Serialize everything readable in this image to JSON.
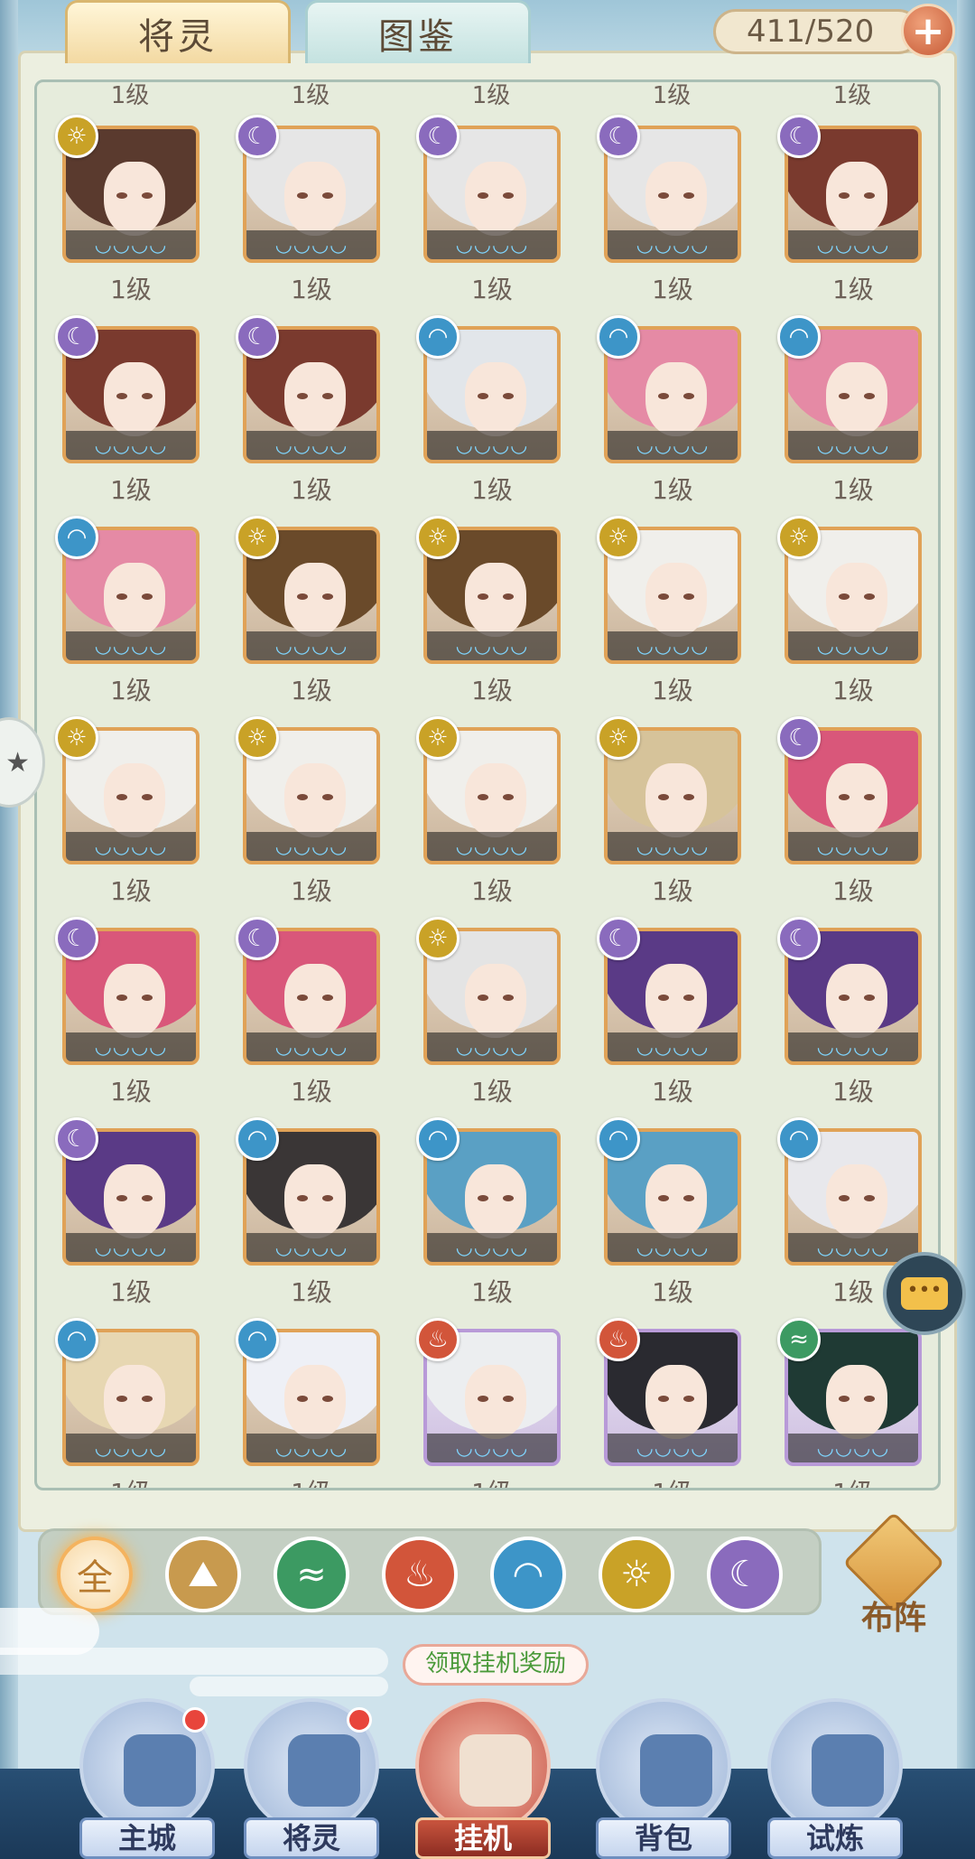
{
  "tabs": [
    {
      "label": "将灵",
      "active": true
    },
    {
      "label": "图鉴",
      "active": false
    }
  ],
  "counter": {
    "text": "411/520",
    "plus": "+"
  },
  "level_label": "1级",
  "drops_glyph": "💧💧💧💧",
  "elements": {
    "light": {
      "name": "light-element-icon",
      "glyph": "☼",
      "color": "#c9a227"
    },
    "moon": {
      "name": "moon-element-icon",
      "glyph": "☾",
      "color": "#8a6bbd"
    },
    "water": {
      "name": "water-element-icon",
      "glyph": "◠",
      "color": "#3d95c8"
    },
    "fire": {
      "name": "fire-element-icon",
      "glyph": "♨",
      "color": "#d2553a"
    },
    "wind": {
      "name": "wind-element-icon",
      "glyph": "≈",
      "color": "#3c9a62"
    }
  },
  "heroes": [
    {
      "element": "light",
      "hair": "#5a3a2e"
    },
    {
      "element": "moon",
      "hair": "#e6e6e6"
    },
    {
      "element": "moon",
      "hair": "#e6e6e6"
    },
    {
      "element": "moon",
      "hair": "#e6e6e6"
    },
    {
      "element": "moon",
      "hair": "#7a3a2e"
    },
    {
      "element": "moon",
      "hair": "#7a3a2e"
    },
    {
      "element": "moon",
      "hair": "#7a3a2e"
    },
    {
      "element": "water",
      "hair": "#e2e6ea"
    },
    {
      "element": "water",
      "hair": "#e58aa5"
    },
    {
      "element": "water",
      "hair": "#e58aa5"
    },
    {
      "element": "water",
      "hair": "#e58aa5"
    },
    {
      "element": "light",
      "hair": "#6a4a2a"
    },
    {
      "element": "light",
      "hair": "#6a4a2a"
    },
    {
      "element": "light",
      "hair": "#f0efeb"
    },
    {
      "element": "light",
      "hair": "#f0efeb"
    },
    {
      "element": "light",
      "hair": "#f0efeb"
    },
    {
      "element": "light",
      "hair": "#f0efeb"
    },
    {
      "element": "light",
      "hair": "#f0efeb"
    },
    {
      "element": "light",
      "hair": "#d6c39a"
    },
    {
      "element": "moon",
      "hair": "#d9577a"
    },
    {
      "element": "moon",
      "hair": "#d9577a"
    },
    {
      "element": "moon",
      "hair": "#d9577a"
    },
    {
      "element": "light",
      "hair": "#e4e4e4"
    },
    {
      "element": "moon",
      "hair": "#5a3a86"
    },
    {
      "element": "moon",
      "hair": "#5a3a86"
    },
    {
      "element": "moon",
      "hair": "#5a3a86"
    },
    {
      "element": "water",
      "hair": "#3a3636"
    },
    {
      "element": "water",
      "hair": "#5aa0c4"
    },
    {
      "element": "water",
      "hair": "#5aa0c4"
    },
    {
      "element": "water",
      "hair": "#e8e8ec"
    },
    {
      "element": "water",
      "hair": "#e7d7b2"
    },
    {
      "element": "water",
      "hair": "#eef0f6"
    },
    {
      "element": "fire",
      "hair": "#eceef0",
      "rare": true
    },
    {
      "element": "fire",
      "hair": "#2a2a30",
      "rare": true
    },
    {
      "element": "wind",
      "hair": "#1f3a34",
      "rare": true
    }
  ],
  "filters": [
    {
      "name": "filter-all-button",
      "label": "全"
    },
    {
      "name": "filter-mountain-button",
      "label": "⛰",
      "color": "#c89a4e"
    },
    {
      "name": "filter-wind-button",
      "label": "≈",
      "color": "#3c9a62"
    },
    {
      "name": "filter-fire-button",
      "label": "♨",
      "color": "#d2553a"
    },
    {
      "name": "filter-water-button",
      "label": "◠",
      "color": "#3d95c8"
    },
    {
      "name": "filter-light-button",
      "label": "☼",
      "color": "#c9a227"
    },
    {
      "name": "filter-moon-button",
      "label": "☾",
      "color": "#8a6bbd"
    }
  ],
  "buzhen_label": "布阵",
  "reward_tag": "领取挂机奖励",
  "nav": [
    {
      "name": "nav-main-city",
      "label": "主城",
      "dot": true
    },
    {
      "name": "nav-heroes",
      "label": "将灵",
      "dot": true
    },
    {
      "name": "nav-idle",
      "label": "挂机",
      "dot": false,
      "center": true
    },
    {
      "name": "nav-bag",
      "label": "背包",
      "dot": false
    },
    {
      "name": "nav-trial",
      "label": "试炼",
      "dot": false
    }
  ]
}
